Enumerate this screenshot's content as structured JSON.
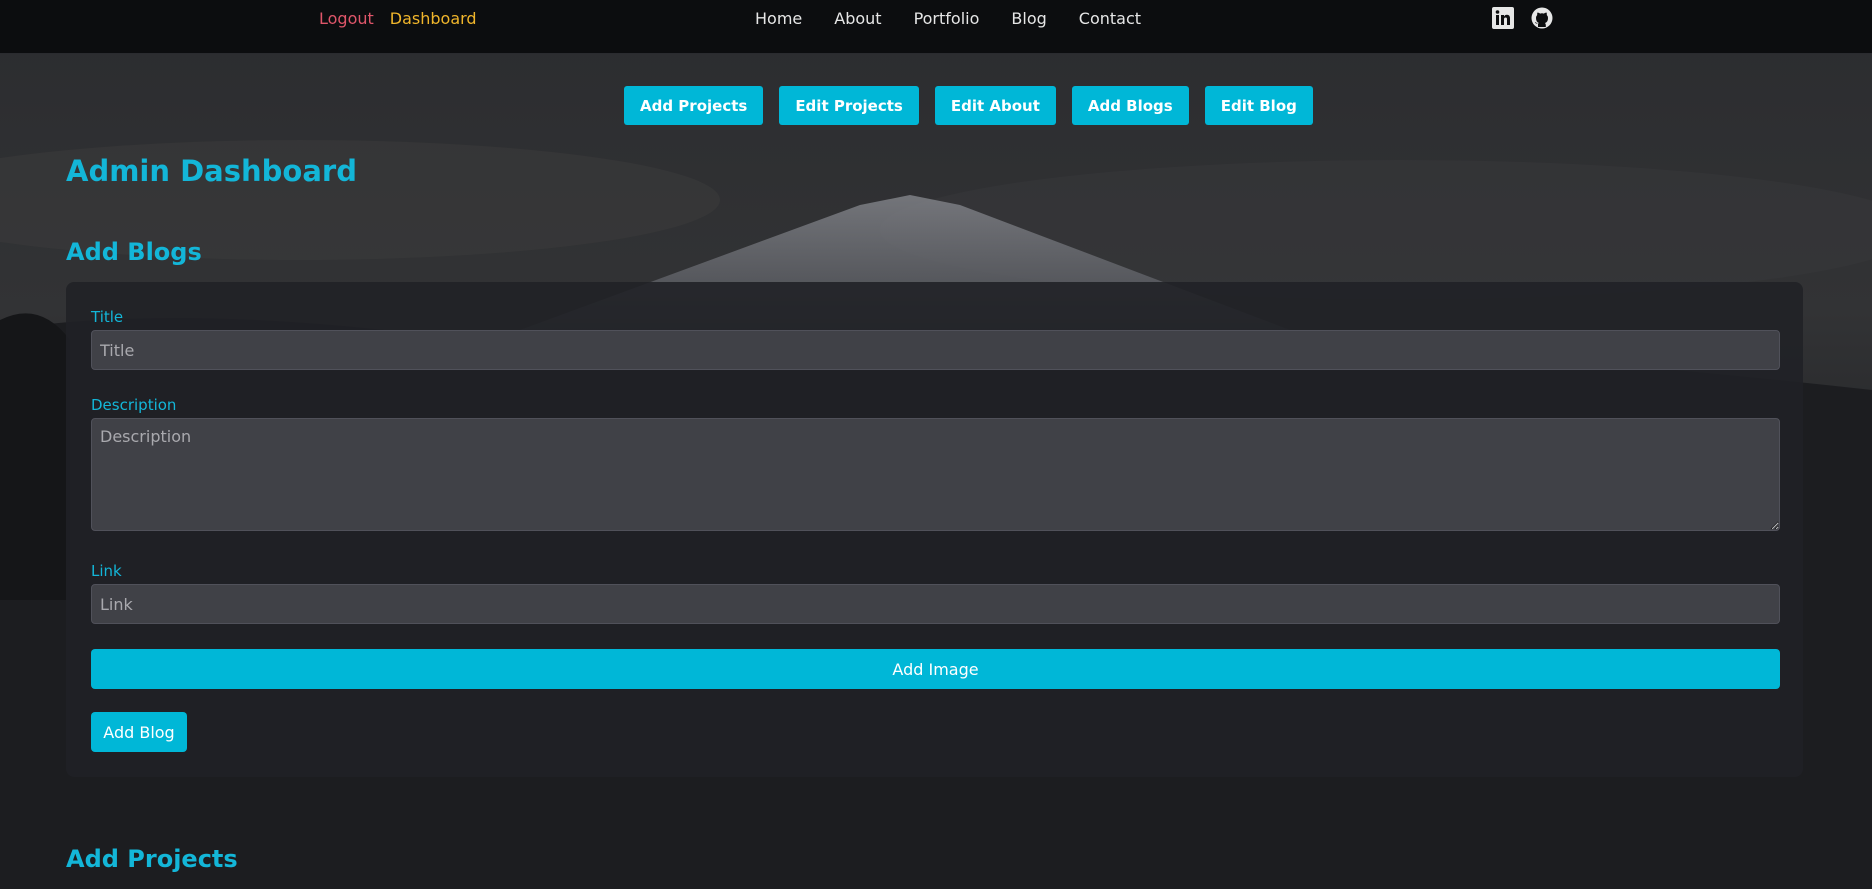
{
  "nav": {
    "logout": "Logout",
    "dashboard": "Dashboard",
    "links": [
      "Home",
      "About",
      "Portfolio",
      "Blog",
      "Contact"
    ],
    "social": [
      {
        "icon": "linkedin-icon"
      },
      {
        "icon": "github-icon"
      }
    ],
    "logout_color": "#e0566a",
    "dashboard_color": "#f0b52b"
  },
  "tabs": [
    "Add Projects",
    "Edit Projects",
    "Edit About",
    "Add Blogs",
    "Edit Blog"
  ],
  "page_title": "Admin Dashboard",
  "add_blogs": {
    "heading": "Add Blogs",
    "title_label": "Title",
    "title_placeholder": "Title",
    "description_label": "Description",
    "description_placeholder": "Description",
    "link_label": "Link",
    "link_placeholder": "Link",
    "add_image_label": "Add Image",
    "submit_label": "Add Blog"
  },
  "add_projects": {
    "heading": "Add Projects"
  },
  "colors": {
    "accent": "#00b7d7",
    "heading": "#13b6d8",
    "navbar": "#0c0d0f"
  }
}
